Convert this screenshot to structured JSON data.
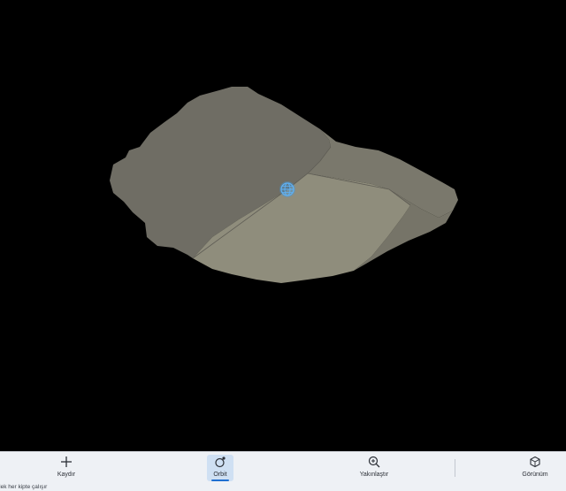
{
  "viewport": {
    "background": "#000000",
    "model_colors": {
      "dark_face": "#6f6d64",
      "light_face": "#8f8d7c",
      "right_face": "#7e7c70",
      "outline": "#57564f"
    },
    "pivot_icon": "orbit-pivot-globe-icon",
    "pivot_color": "#3d9be9"
  },
  "toolbar": {
    "pan_label": "Kaydır",
    "orbit_label": "Orbit",
    "zoom_label": "Yakınlaştır",
    "view_label": "Görünüm",
    "active_tool": "orbit",
    "accent": "#1f6fd1"
  },
  "status": {
    "text": "rlek her kipte çalışır"
  }
}
